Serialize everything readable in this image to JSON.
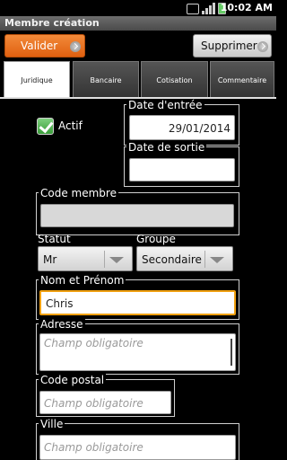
{
  "status_bar": {
    "time": "10:02 AM"
  },
  "window": {
    "title": "Membre création"
  },
  "toolbar": {
    "valider_label": "Valider",
    "supprimer_label": "Supprimer"
  },
  "tabs": [
    {
      "label": "Juridique",
      "active": true
    },
    {
      "label": "Bancaire",
      "active": false
    },
    {
      "label": "Cotisation",
      "active": false
    },
    {
      "label": "Commentaire",
      "active": false
    }
  ],
  "form": {
    "actif": {
      "label": "Actif",
      "checked": true
    },
    "date_entree": {
      "label": "Date d'entrée",
      "value": "29/01/2014"
    },
    "date_sortie": {
      "label": "Date de sortie",
      "value": ""
    },
    "code_membre": {
      "label": "Code membre",
      "value": ""
    },
    "statut": {
      "label": "Statut",
      "value": "Mr"
    },
    "groupe": {
      "label": "Groupe",
      "value": "Secondaire"
    },
    "nom_prenom": {
      "label": "Nom et Prénom",
      "value": "Chris"
    },
    "adresse": {
      "label": "Adresse",
      "placeholder": "Champ obligatoire"
    },
    "code_postal": {
      "label": "Code postal",
      "placeholder": "Champ obligatoire"
    },
    "ville": {
      "label": "Ville",
      "placeholder": "Champ obligatoire"
    }
  },
  "colors": {
    "accent": "#e87020",
    "focus": "#f0a010",
    "checkbox": "#3a9c3a"
  }
}
